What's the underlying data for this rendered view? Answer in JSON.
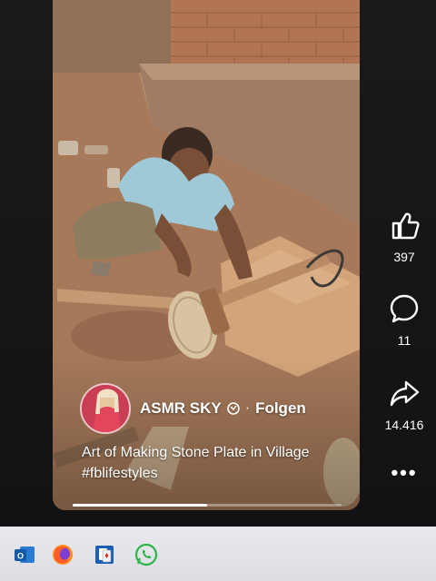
{
  "post": {
    "author": "ASMR SKY",
    "follow_label": "Folgen",
    "separator": "·",
    "caption": "Art of Making Stone Plate in Village #fblifestyles",
    "progress": 0.5
  },
  "actions": {
    "likes": "397",
    "comments": "11",
    "shares": "14.416"
  },
  "taskbar": {
    "apps": [
      "outlook-icon",
      "firefox-icon",
      "solitaire-icon",
      "whatsapp-icon"
    ]
  },
  "colors": {
    "accent_follow": "#ffffff",
    "taskbar": "#e3e4e9"
  }
}
